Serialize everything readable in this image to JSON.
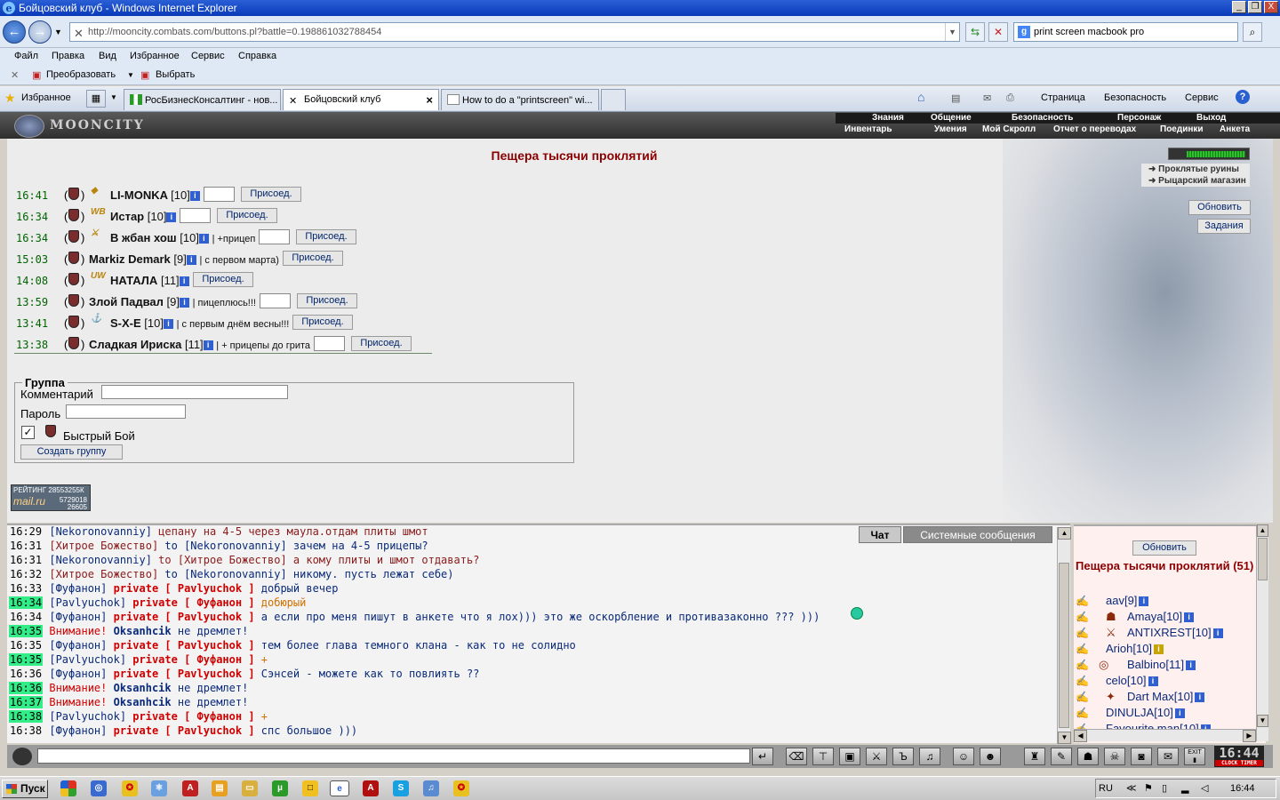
{
  "window": {
    "title": "Бойцовский клуб - Windows Internet Explorer",
    "minimize": "_",
    "restore": "❐",
    "close": "X"
  },
  "browser": {
    "back": "←",
    "forward": "→",
    "address": "http://mooncity.combats.com/buttons.pl?battle=0.198861032788454",
    "search_value": "print screen macbook pro",
    "menu": [
      "Файл",
      "Правка",
      "Вид",
      "Избранное",
      "Сервис",
      "Справка"
    ],
    "convert_label": "Преобразовать",
    "select_label": "Выбрать",
    "favorites_label": "Избранное",
    "tabs": [
      {
        "label": "РосБизнесКонсалтинг - нов..."
      },
      {
        "label": "Бойцовский клуб"
      },
      {
        "label": "How to do a \"printscreen\" wi..."
      }
    ],
    "tab_close": "×",
    "right_tools": [
      "Страница",
      "Безопасность",
      "Сервис"
    ]
  },
  "game": {
    "logo": "MOONCITY",
    "top_menu": [
      "Знания",
      "Общение",
      "Безопасность",
      "Персонаж",
      "Выход"
    ],
    "sub_menu": [
      "Инвентарь",
      "Умения",
      "Мой Скролл",
      "Отчет о переводах",
      "Поединки",
      "Анкета"
    ],
    "location_title": "Пещера тысячи проклятий",
    "links": [
      "Проклятые руины",
      "Рыцарский магазин"
    ],
    "refresh_button": "Обновить",
    "tasks_button": "Задания",
    "join_label": "Присоед.",
    "battles": [
      {
        "time": "16:41",
        "emblem": "◆",
        "name": "LI-MONKA",
        "level": "[10]",
        "comment": "",
        "has_input": true
      },
      {
        "time": "16:34",
        "emblem": "WB",
        "name": "Истар",
        "level": "[10]",
        "comment": "",
        "has_input": true
      },
      {
        "time": "16:34",
        "emblem": "⚔",
        "name": "В жбан хош",
        "level": "[10]",
        "comment": "| +прицеп",
        "has_input": true
      },
      {
        "time": "15:03",
        "emblem": "",
        "name": "Markiz Demark",
        "level": "[9]",
        "comment": "| с первом марта)",
        "has_input": false
      },
      {
        "time": "14:08",
        "emblem": "UW",
        "name": "НАТАЛА",
        "level": "[11]",
        "comment": "",
        "has_input": false
      },
      {
        "time": "13:59",
        "emblem": "",
        "name": "Злой Падвал",
        "level": "[9]",
        "comment": "| пицеплюсь!!!",
        "has_input": true
      },
      {
        "time": "13:41",
        "emblem": "⚓",
        "name": "S-X-E",
        "level": "[10]",
        "comment": "| с первым днём весны!!!",
        "has_input": false
      },
      {
        "time": "13:38",
        "emblem": "",
        "name": "Сладкая Ириска",
        "level": "[11]",
        "comment": "| + прицепы до грита",
        "has_input": true
      }
    ],
    "group": {
      "legend": "Группа",
      "comment_label": "Комментарий",
      "password_label": "Пароль",
      "fast_battle_label": "Быстрый Бой",
      "fast_battle_checked": true,
      "create_button": "Создать группу"
    },
    "rating": {
      "line1": "РЕЙТИНГ 28553255К",
      "brand": "mail.ru",
      "n1": "5729018",
      "n2": "26605"
    }
  },
  "chat": {
    "tab_chat": "Чат",
    "tab_system": "Системные сообщения",
    "lines": [
      [
        {
          "c": "tm",
          "t": "16:29"
        },
        {
          "c": "a",
          "t": " [Nekoronovanniy]"
        },
        {
          "c": "n",
          "t": " цепану на 4-5 через маула.отдам плиты шмот"
        }
      ],
      [
        {
          "c": "tm",
          "t": "16:31"
        },
        {
          "c": "n",
          "t": " [Хитрое Божество]"
        },
        {
          "c": "a",
          "t": " to [Nekoronovanniy] зачем на 4-5 прицепы?"
        }
      ],
      [
        {
          "c": "tm",
          "t": "16:31"
        },
        {
          "c": "a",
          "t": " [Nekoronovanniy]"
        },
        {
          "c": "n",
          "t": " to [Хитрое Божество] а кому плиты и шмот отдавать?"
        }
      ],
      [
        {
          "c": "tm",
          "t": "16:32"
        },
        {
          "c": "n",
          "t": " [Хитрое Божество]"
        },
        {
          "c": "a",
          "t": " to [Nekoronovanniy] никому. пусть лежат себе)"
        }
      ],
      [
        {
          "c": "tm",
          "t": "16:33"
        },
        {
          "c": "a",
          "t": " [Фуфанон]"
        },
        {
          "c": "pv",
          "t": " private [ Pavlyuchok ]"
        },
        {
          "c": "a",
          "t": " добрый вечер"
        }
      ],
      [
        {
          "c": "tmh",
          "t": "16:34"
        },
        {
          "c": "a",
          "t": " [Pavlyuchok]"
        },
        {
          "c": "pv",
          "t": " private [ Фуфанон ]"
        },
        {
          "c": "o",
          "t": " добюрый"
        }
      ],
      [
        {
          "c": "tm",
          "t": "16:34"
        },
        {
          "c": "a",
          "t": " [Фуфанон]"
        },
        {
          "c": "pv",
          "t": " private [ Pavlyuchok ]"
        },
        {
          "c": "a",
          "t": " а если про меня пишут в анкете что я лох))) это же оскорбление и противазаконно ??? )))"
        }
      ],
      [
        {
          "c": "tmh",
          "t": "16:35"
        },
        {
          "c": "w",
          "t": " Внимание!"
        },
        {
          "c": "u",
          "t": " Oksanhcik"
        },
        {
          "c": "a",
          "t": " не дремлет!"
        }
      ],
      [
        {
          "c": "tm",
          "t": "16:35"
        },
        {
          "c": "a",
          "t": " [Фуфанон]"
        },
        {
          "c": "pv",
          "t": " private [ Pavlyuchok ]"
        },
        {
          "c": "a",
          "t": " тем более глава темного клана - как то не солидно"
        }
      ],
      [
        {
          "c": "tmh",
          "t": "16:35"
        },
        {
          "c": "a",
          "t": " [Pavlyuchok]"
        },
        {
          "c": "pv",
          "t": " private [ Фуфанон ]"
        },
        {
          "c": "o",
          "t": " +"
        }
      ],
      [
        {
          "c": "tm",
          "t": "16:36"
        },
        {
          "c": "a",
          "t": " [Фуфанон]"
        },
        {
          "c": "pv",
          "t": " private [ Pavlyuchok ]"
        },
        {
          "c": "a",
          "t": " Сэнсей - можете как то повлиять ??"
        }
      ],
      [
        {
          "c": "tmh",
          "t": "16:36"
        },
        {
          "c": "w",
          "t": " Внимание!"
        },
        {
          "c": "u",
          "t": " Oksanhcik"
        },
        {
          "c": "a",
          "t": " не дремлет!"
        }
      ],
      [
        {
          "c": "tmh",
          "t": "16:37"
        },
        {
          "c": "w",
          "t": " Внимание!"
        },
        {
          "c": "u",
          "t": " Oksanhcik"
        },
        {
          "c": "a",
          "t": " не дремлет!"
        }
      ],
      [
        {
          "c": "tmh",
          "t": "16:38"
        },
        {
          "c": "a",
          "t": " [Pavlyuchok]"
        },
        {
          "c": "pv",
          "t": " private [ Фуфанон ]"
        },
        {
          "c": "o",
          "t": " +"
        }
      ],
      [
        {
          "c": "tm",
          "t": "16:38"
        },
        {
          "c": "a",
          "t": " [Фуфанон]"
        },
        {
          "c": "pv",
          "t": " private [ Pavlyuchok ]"
        },
        {
          "c": "a",
          "t": " спс большое )))"
        }
      ]
    ]
  },
  "online": {
    "refresh_button": "Обновить",
    "title": "Пещера тысячи проклятий (51)",
    "users": [
      {
        "name": "aav",
        "level": "[9]"
      },
      {
        "name": "Amaya",
        "level": "[10]"
      },
      {
        "name": "ANTIXREST",
        "level": "[10]"
      },
      {
        "name": "Arioh",
        "level": "[10]"
      },
      {
        "name": "Balbino",
        "level": "[11]"
      },
      {
        "name": "celo",
        "level": "[10]"
      },
      {
        "name": "Dart Max",
        "level": "[10]"
      },
      {
        "name": "DINULJA",
        "level": "[10]"
      },
      {
        "name": "Favourite man",
        "level": "[10]"
      }
    ]
  },
  "bottom_bar": {
    "clock_time": "16:44",
    "clock_label": "CLOCK TIMER",
    "exit_label": "EXIT"
  },
  "taskbar": {
    "start_label": "Пуск",
    "language": "RU",
    "time": "16:44"
  }
}
